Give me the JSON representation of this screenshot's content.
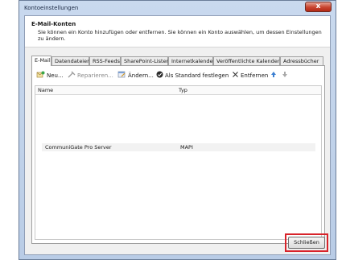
{
  "window": {
    "title": "Kontoeinstellungen",
    "close_glyph": "x"
  },
  "header": {
    "title": "E-Mail-Konten",
    "description": "Sie können ein Konto hinzufügen oder entfernen. Sie können ein Konto auswählen, um dessen Einstellungen zu ändern."
  },
  "tabs": [
    {
      "label": "E-Mail",
      "active": true
    },
    {
      "label": "Datendateien"
    },
    {
      "label": "RSS-Feeds"
    },
    {
      "label": "SharePoint-Listen"
    },
    {
      "label": "Internetkalender"
    },
    {
      "label": "Veröffentlichte Kalender"
    },
    {
      "label": "Adressbücher"
    }
  ],
  "toolbar": {
    "new": "Neu...",
    "repair": "Reparieren...",
    "change": "Ändern...",
    "set_default": "Als Standard festlegen",
    "remove": "Entfernen",
    "icons": [
      "new-account-icon",
      "repair-icon",
      "change-icon",
      "default-check-icon",
      "remove-x-icon",
      "move-up-icon",
      "move-down-icon"
    ]
  },
  "table": {
    "columns": [
      "Name",
      "Typ"
    ],
    "rows": [
      {
        "name": "CommuniGate Pro Server",
        "type": "MAPI"
      }
    ]
  },
  "footer": {
    "close_label": "Schließen",
    "highlight_color": "#d8232a"
  }
}
